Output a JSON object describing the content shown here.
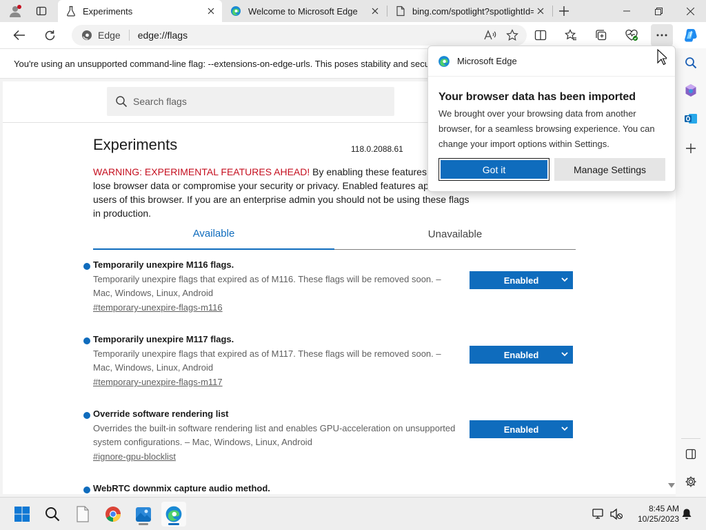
{
  "tabs": [
    {
      "title": "Experiments",
      "active": true
    },
    {
      "title": "Welcome to Microsoft Edge",
      "active": false
    },
    {
      "title": "bing.com/spotlight?spotlightId=",
      "active": false
    }
  ],
  "omnibox": {
    "site_label": "Edge",
    "url": "edge://flags"
  },
  "infobar": {
    "text": "You're using an unsupported command-line flag: --extensions-on-edge-urls. This poses stability and secu"
  },
  "page": {
    "search_placeholder": "Search flags",
    "title": "Experiments",
    "version": "118.0.2088.61",
    "warning_prefix": "WARNING: EXPERIMENTAL FEATURES AHEAD!",
    "warning_text": " By enabling these features, you could lose browser data or compromise your security or privacy. Enabled features apply to all users of this browser. If you are an enterprise admin you should not be using these flags in production.",
    "tab_available": "Available",
    "tab_unavailable": "Unavailable",
    "flags": [
      {
        "name": "Temporarily unexpire M116 flags.",
        "desc": "Temporarily unexpire flags that expired as of M116. These flags will be removed soon. – Mac, Windows, Linux, Android",
        "link": "#temporary-unexpire-flags-m116",
        "value": "Enabled"
      },
      {
        "name": "Temporarily unexpire M117 flags.",
        "desc": "Temporarily unexpire flags that expired as of M117. These flags will be removed soon. – Mac, Windows, Linux, Android",
        "link": "#temporary-unexpire-flags-m117",
        "value": "Enabled"
      },
      {
        "name": "Override software rendering list",
        "desc": "Overrides the built-in software rendering list and enables GPU-acceleration on unsupported system configurations. – Mac, Windows, Linux, Android",
        "link": "#ignore-gpu-blocklist",
        "value": "Enabled"
      },
      {
        "name": "WebRTC downmix capture audio method."
      }
    ]
  },
  "popup": {
    "header": "Microsoft Edge",
    "title": "Your browser data has been imported",
    "body": "We brought over your browsing data from another browser, for a seamless browsing experience. You can change your import options within Settings.",
    "primary_button": "Got it",
    "secondary_button": "Manage Settings"
  },
  "clock": {
    "time": "8:45 AM",
    "date": "10/25/2023"
  },
  "colors": {
    "accent": "#0f6cbd",
    "warning": "#c50f1f"
  }
}
